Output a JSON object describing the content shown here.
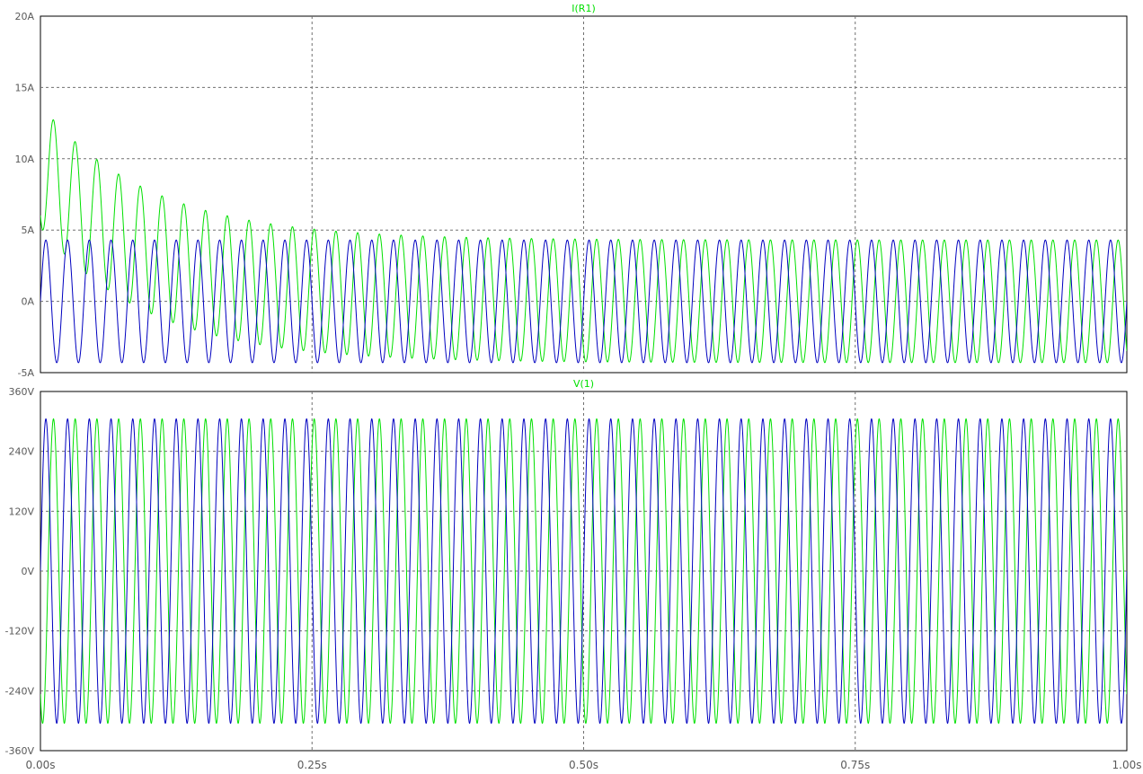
{
  "chart_data": [
    {
      "type": "line",
      "title": "I(R1)",
      "title_color": "#00e000",
      "xlabel": "",
      "ylabel": "",
      "x_range": [
        0,
        1.0
      ],
      "ylim": [
        -5,
        20
      ],
      "y_ticks": [
        {
          "value": 20,
          "label": "20A"
        },
        {
          "value": 15,
          "label": "15A"
        },
        {
          "value": 10,
          "label": "10A"
        },
        {
          "value": 5,
          "label": "5A"
        },
        {
          "value": 0,
          "label": "0A"
        },
        {
          "value": -5,
          "label": "-5A"
        }
      ],
      "grid": true,
      "series": [
        {
          "color": "#00e000",
          "frequency_hz": 50,
          "phase_lag_cycles": 0.35,
          "steady_amplitude": 4.3,
          "dc_initial": 9.5,
          "dc_time_constant_s": 0.1,
          "first_peak": 14.2,
          "min": -4.3
        },
        {
          "color": "#0000c0",
          "frequency_hz": 50,
          "amplitude": 4.3,
          "phase_lag_cycles": 0
        }
      ]
    },
    {
      "type": "line",
      "title": "V(1)",
      "title_color": "#00e000",
      "xlabel": "",
      "ylabel": "",
      "x_range": [
        0,
        1.0
      ],
      "ylim": [
        -360,
        360
      ],
      "y_ticks": [
        {
          "value": 360,
          "label": "360V"
        },
        {
          "value": 240,
          "label": "240V"
        },
        {
          "value": 120,
          "label": "120V"
        },
        {
          "value": 0,
          "label": "0V"
        },
        {
          "value": -120,
          "label": "-120V"
        },
        {
          "value": -240,
          "label": "-240V"
        },
        {
          "value": -360,
          "label": "-360V"
        }
      ],
      "grid": true,
      "series": [
        {
          "color": "#00e000",
          "frequency_hz": 50,
          "amplitude": 305,
          "phase_lag_cycles": 0.35
        },
        {
          "color": "#0000c0",
          "frequency_hz": 50,
          "amplitude": 305,
          "phase_lag_cycles": 0
        }
      ]
    }
  ],
  "x_ticks": [
    {
      "value": 0,
      "label": "0.00s"
    },
    {
      "value": 0.25,
      "label": "0.25s"
    },
    {
      "value": 0.5,
      "label": "0.50s"
    },
    {
      "value": 0.75,
      "label": "0.75s"
    },
    {
      "value": 1.0,
      "label": "1.00s"
    }
  ]
}
